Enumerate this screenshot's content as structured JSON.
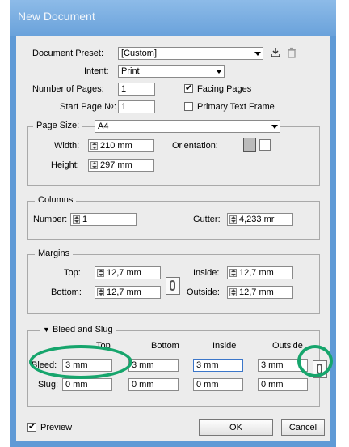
{
  "window": {
    "title": "New Document"
  },
  "preset": {
    "label": "Document Preset:",
    "value": "[Custom]"
  },
  "intent": {
    "label": "Intent:",
    "value": "Print"
  },
  "pages": {
    "label": "Number of Pages:",
    "value": "1",
    "facing_label": "Facing Pages",
    "facing_checked": true
  },
  "startpage": {
    "label": "Start Page №:",
    "value": "1",
    "primary_label": "Primary Text Frame",
    "primary_checked": false
  },
  "page_size": {
    "label": "Page Size:",
    "value": "A4",
    "width_label": "Width:",
    "width": "210 mm",
    "height_label": "Height:",
    "height": "297 mm",
    "orientation_label": "Orientation:"
  },
  "columns": {
    "group_label": "Columns",
    "number_label": "Number:",
    "number": "1",
    "gutter_label": "Gutter:",
    "gutter": "4,233 mr"
  },
  "margins": {
    "group_label": "Margins",
    "top_label": "Top:",
    "top": "12,7 mm",
    "bottom_label": "Bottom:",
    "bottom": "12,7 mm",
    "inside_label": "Inside:",
    "inside": "12,7 mm",
    "outside_label": "Outside:",
    "outside": "12,7 mm"
  },
  "bleed_slug": {
    "group_label": "Bleed and Slug",
    "headers": [
      "Top",
      "Bottom",
      "Inside",
      "Outside"
    ],
    "bleed_label": "Bleed:",
    "bleed": [
      "3 mm",
      "3 mm",
      "3 mm",
      "3 mm"
    ],
    "slug_label": "Slug:",
    "slug": [
      "0 mm",
      "0 mm",
      "0 mm",
      "0 mm"
    ]
  },
  "preview": {
    "label": "Preview",
    "checked": true
  },
  "buttons": {
    "ok": "OK",
    "cancel": "Cancel"
  },
  "highlight_color": "#16a56c"
}
